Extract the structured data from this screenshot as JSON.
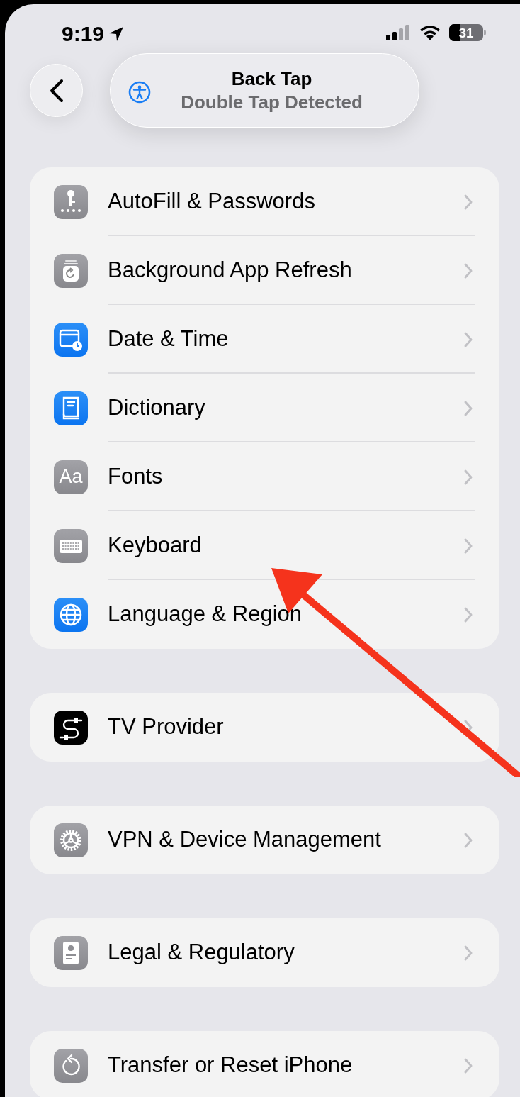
{
  "status_bar": {
    "time": "9:19",
    "battery": "31"
  },
  "header": {
    "title": "Back Tap",
    "subtitle": "Double Tap Detected"
  },
  "groups": [
    {
      "items": [
        {
          "label": "AutoFill & Passwords"
        },
        {
          "label": "Background App Refresh"
        },
        {
          "label": "Date & Time"
        },
        {
          "label": "Dictionary"
        },
        {
          "label": "Fonts",
          "icon_text": "Aa"
        },
        {
          "label": "Keyboard"
        },
        {
          "label": "Language & Region"
        }
      ]
    },
    {
      "items": [
        {
          "label": "TV Provider"
        }
      ]
    },
    {
      "items": [
        {
          "label": "VPN & Device Management"
        }
      ]
    },
    {
      "items": [
        {
          "label": "Legal & Regulatory"
        }
      ]
    },
    {
      "items": [
        {
          "label": "Transfer or Reset iPhone"
        }
      ]
    }
  ]
}
